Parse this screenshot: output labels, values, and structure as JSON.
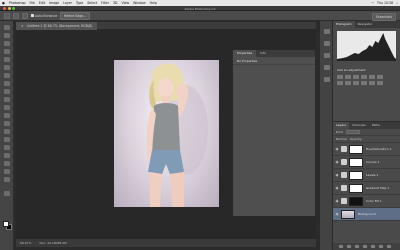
{
  "menubar": {
    "items": [
      "Photoshop",
      "File",
      "Edit",
      "Image",
      "Layer",
      "Type",
      "Select",
      "Filter",
      "3D",
      "View",
      "Window",
      "Help"
    ],
    "clock": "Thu 10:58"
  },
  "app": {
    "title": "Adobe Photoshop CC"
  },
  "options": {
    "auto_enhance": "Auto Enhance",
    "refine_edge": "Refine Edge...",
    "workspace": "Essentials"
  },
  "document": {
    "tab_label": "Untitled-1 @ 66.7% (Background, RGB/8)",
    "zoom": "66.67%",
    "doc_size": "Doc: 22.1M/88.2M"
  },
  "float_panel": {
    "tab1": "Properties",
    "tab2": "Info",
    "header": "No Properties"
  },
  "right": {
    "hist_tab": "Histogram",
    "nav_tab": "Navigator",
    "adjust_label": "Add an adjustment",
    "layers_tab": "Layers",
    "channels_tab": "Channels",
    "paths_tab": "Paths",
    "kind_label": "Kind",
    "normal": "Normal",
    "opacity": "Opacity:",
    "layers": [
      {
        "name": "Hue/Saturation 1"
      },
      {
        "name": "Curves 1"
      },
      {
        "name": "Levels 1"
      },
      {
        "name": "Gradient Map 1"
      },
      {
        "name": "Color Fill 1"
      },
      {
        "name": "Background",
        "selected": true
      }
    ]
  }
}
